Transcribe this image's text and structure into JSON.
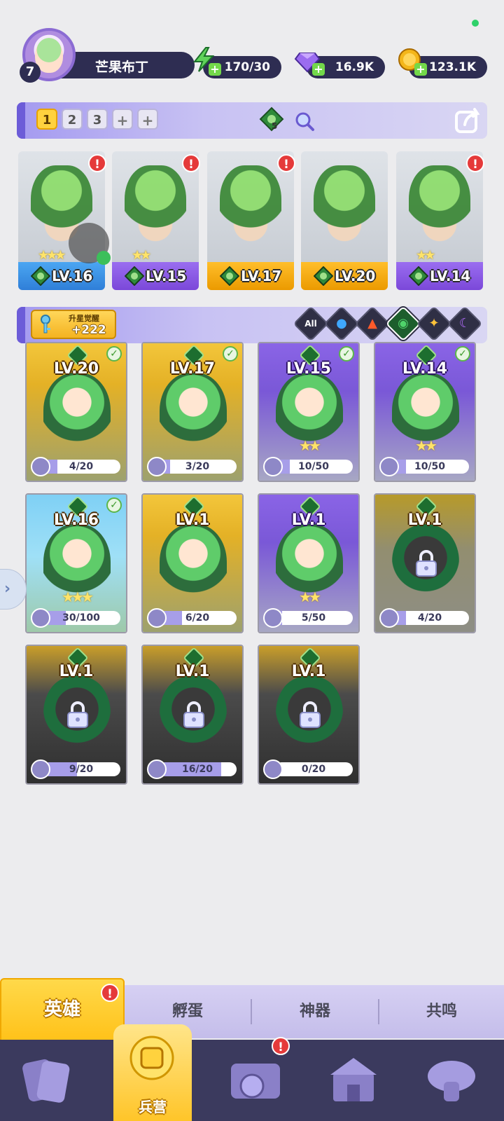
{
  "player": {
    "level": "7",
    "name": "芒果布丁"
  },
  "resources": [
    {
      "icon": "energy-icon",
      "value": "170/30",
      "color": "#5fd35a"
    },
    {
      "icon": "gem-icon",
      "value": "16.9K",
      "color": "#9b6cf0"
    },
    {
      "icon": "gold-coin-icon",
      "value": "123.1K",
      "color": "#f4b61a"
    }
  ],
  "team_bar": {
    "tabs": [
      "1",
      "2",
      "3",
      "+",
      "+"
    ],
    "active_tab": "1",
    "element_count": "5"
  },
  "team_heroes": [
    {
      "level": "LV.16",
      "rarity": "blue",
      "stars": "★★★",
      "alert": "!"
    },
    {
      "level": "LV.15",
      "rarity": "purple",
      "stars": "★★",
      "alert": "!"
    },
    {
      "level": "LV.17",
      "rarity": "gold",
      "stars": "",
      "alert": "!"
    },
    {
      "level": "LV.20",
      "rarity": "gold",
      "stars": "",
      "alert": ""
    },
    {
      "level": "LV.14",
      "rarity": "purple",
      "stars": "★★",
      "alert": "!"
    }
  ],
  "awaken": {
    "title": "升星觉醒",
    "value": "+222"
  },
  "element_filters": [
    {
      "label": "All",
      "icon": "all-filter-icon",
      "color": "#ffffff"
    },
    {
      "label": "💧",
      "icon": "water-element-icon",
      "color": "#3fa8ff"
    },
    {
      "label": "🔥",
      "icon": "fire-element-icon",
      "color": "#ff5a2a"
    },
    {
      "label": "◉",
      "icon": "wind-element-icon",
      "color": "#4fd36a"
    },
    {
      "label": "✦",
      "icon": "light-element-icon",
      "color": "#ffc23a"
    },
    {
      "label": "☾",
      "icon": "dark-element-icon",
      "color": "#b36cff"
    }
  ],
  "roster": [
    {
      "level": "LV.20",
      "rarity": "gold",
      "shards": "4/20",
      "progress": 0.2,
      "owned": true,
      "stars": ""
    },
    {
      "level": "LV.17",
      "rarity": "gold",
      "shards": "3/20",
      "progress": 0.15,
      "owned": true,
      "stars": ""
    },
    {
      "level": "LV.15",
      "rarity": "purple",
      "shards": "10/50",
      "progress": 0.2,
      "owned": true,
      "stars": "★★"
    },
    {
      "level": "LV.14",
      "rarity": "purple",
      "shards": "10/50",
      "progress": 0.2,
      "owned": true,
      "stars": "★★"
    },
    {
      "level": "LV.16",
      "rarity": "blue",
      "shards": "30/100",
      "progress": 0.3,
      "owned": true,
      "stars": "★★★"
    },
    {
      "level": "LV.1",
      "rarity": "gold",
      "shards": "6/20",
      "progress": 0.3,
      "owned": false,
      "stars": ""
    },
    {
      "level": "LV.1",
      "rarity": "purple",
      "shards": "5/50",
      "progress": 0.1,
      "owned": false,
      "stars": "★★"
    },
    {
      "level": "LV.1",
      "rarity": "olive",
      "shards": "4/20",
      "progress": 0.2,
      "owned": false,
      "locked": true,
      "stars": ""
    },
    {
      "level": "LV.1",
      "rarity": "dark",
      "shards": "9/20",
      "progress": 0.45,
      "owned": false,
      "locked": true,
      "stars": ""
    },
    {
      "level": "LV.1",
      "rarity": "dark",
      "shards": "16/20",
      "progress": 0.8,
      "owned": false,
      "locked": true,
      "stars": ""
    },
    {
      "level": "LV.1",
      "rarity": "dark",
      "shards": "0/20",
      "progress": 0.0,
      "owned": false,
      "locked": true,
      "stars": ""
    }
  ],
  "subtabs": [
    "英雄",
    "孵蛋",
    "神器",
    "共鸣"
  ],
  "subtab_alert": "!",
  "nav": {
    "items": [
      "cards-icon",
      "barracks-icon",
      "map-icon",
      "temple-icon",
      "mushroom-icon"
    ],
    "center_label": "兵营",
    "map_alert": "!"
  }
}
